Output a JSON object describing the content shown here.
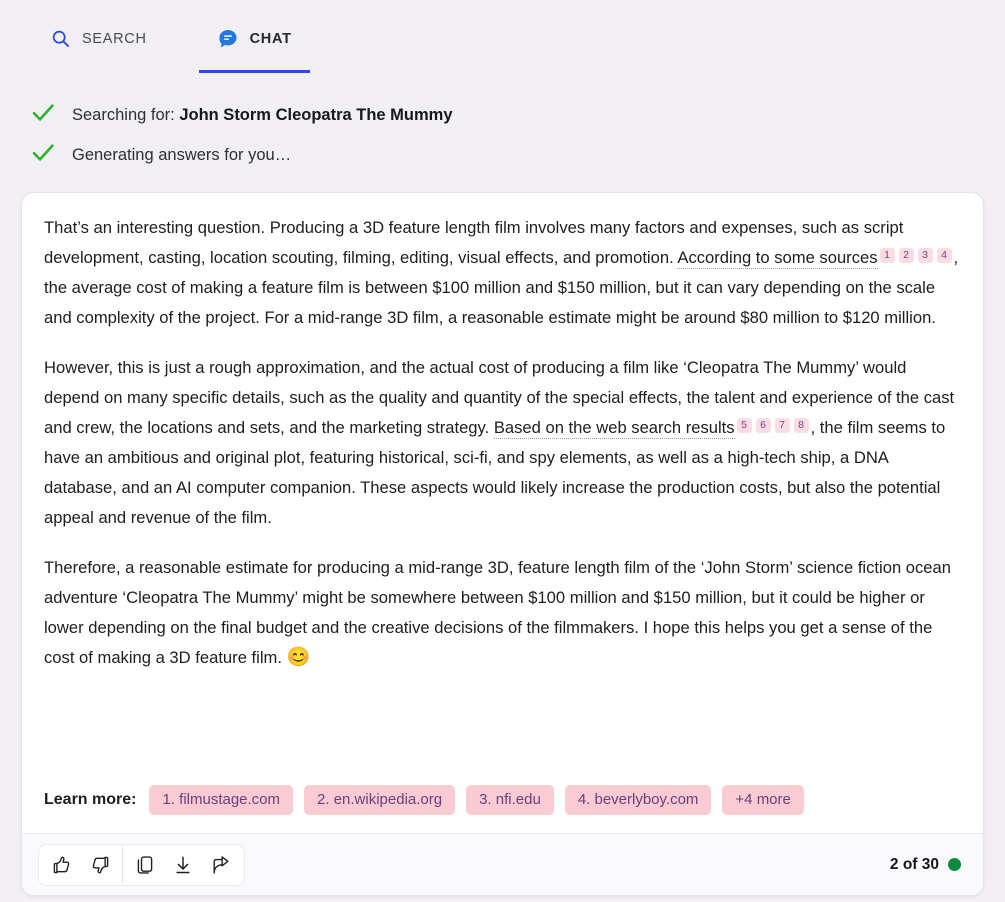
{
  "tabs": [
    {
      "id": "search",
      "label": "SEARCH",
      "icon": "search-icon",
      "active": false
    },
    {
      "id": "chat",
      "label": "CHAT",
      "icon": "chat-bubble-icon",
      "active": true
    }
  ],
  "status": [
    {
      "icon": "check-icon",
      "prefix": "Searching for: ",
      "query": "John Storm Cleopatra The Mummy"
    },
    {
      "icon": "check-icon",
      "prefix": "Generating answers for you…",
      "query": ""
    }
  ],
  "answer": {
    "paragraph1": {
      "before_anchor": "That’s an interesting question. Producing a 3D feature length film involves many factors and expenses, such as script development, casting, location scouting, filming, editing, visual effects, and promotion. ",
      "anchor": "According to some sources",
      "badges": [
        "1",
        "2",
        "3",
        "4"
      ],
      "after_anchor": ", the average cost of making a feature film is between $100 million and $150 million, but it can vary depending on the scale and complexity of the project. For a mid-range 3D film, a reasonable estimate might be around $80 million to $120 million."
    },
    "paragraph2": {
      "before_anchor": "However, this is just a rough approximation, and the actual cost of producing a film like ‘Cleopatra The Mummy’ would depend on many specific details, such as the quality and quantity of the special effects, the talent and experience of the cast and crew, the locations and sets, and the marketing strategy. ",
      "anchor": "Based on the web search results",
      "badges": [
        "5",
        "6",
        "7",
        "8"
      ],
      "after_anchor": ", the film seems to have an ambitious and original plot, featuring historical, sci-fi, and spy elements, as well as a high-tech ship, a DNA database, and an AI computer companion. These aspects would likely increase the production costs, but also the potential appeal and revenue of the film."
    },
    "paragraph3": {
      "text": "Therefore, a reasonable estimate for producing a mid-range 3D, feature length film of the ‘John Storm’ science fiction ocean adventure ‘Cleopatra The Mummy’ might be somewhere between $100 million and $150 million, but it could be higher or lower depending on the final budget and the creative decisions of the filmmakers. I hope this helps you get a sense of the cost of making a 3D feature film. ",
      "emoji": "😊"
    }
  },
  "learn_more": {
    "label": "Learn more:",
    "chips": [
      "1. filmustage.com",
      "2. en.wikipedia.org",
      "3. nfi.edu",
      "4. beverlyboy.com",
      "+4 more"
    ]
  },
  "footer": {
    "actions": [
      {
        "name": "thumbs-up-icon",
        "label": "Like"
      },
      {
        "name": "thumbs-down-icon",
        "label": "Dislike"
      },
      {
        "name": "copy-icon",
        "label": "Copy"
      },
      {
        "name": "download-icon",
        "label": "Export"
      },
      {
        "name": "share-icon",
        "label": "Share"
      }
    ],
    "counter": "2 of 30",
    "status_dot_color": "#0e8a3e"
  },
  "colors": {
    "page_bg": "#f1eff4",
    "accent_blue": "#2b4ae3",
    "badge_bg": "#f9dde2",
    "badge_text": "#7a3f86",
    "chip_bg": "#f8ccd2",
    "chip_text": "#6e3c7e",
    "check_green": "#2db52d"
  }
}
